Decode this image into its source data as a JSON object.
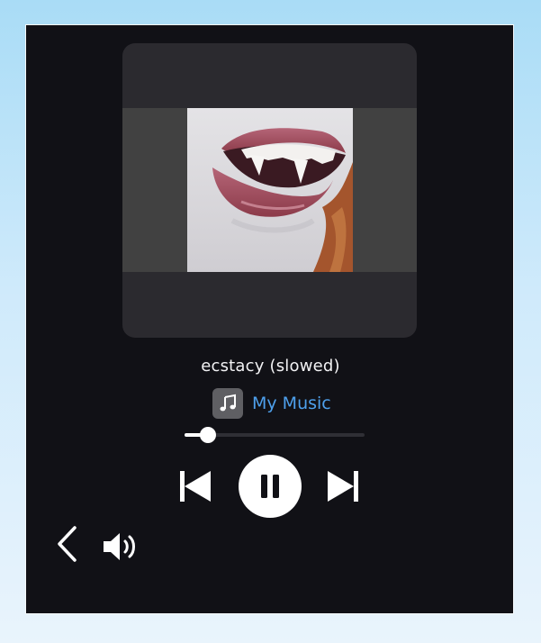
{
  "player": {
    "track_title": "ecstacy (slowed)",
    "source_icon": "music-note-icon",
    "source_label": "My Music",
    "progress_fraction": 0.13,
    "icons": {
      "previous": "skip-previous-icon",
      "pause": "pause-icon",
      "next": "skip-next-icon",
      "back": "chevron-left-icon",
      "volume": "volume-icon"
    },
    "colors": {
      "background": "#111116",
      "accent": "#4ea0ec",
      "card": "#2b2a2f"
    }
  }
}
